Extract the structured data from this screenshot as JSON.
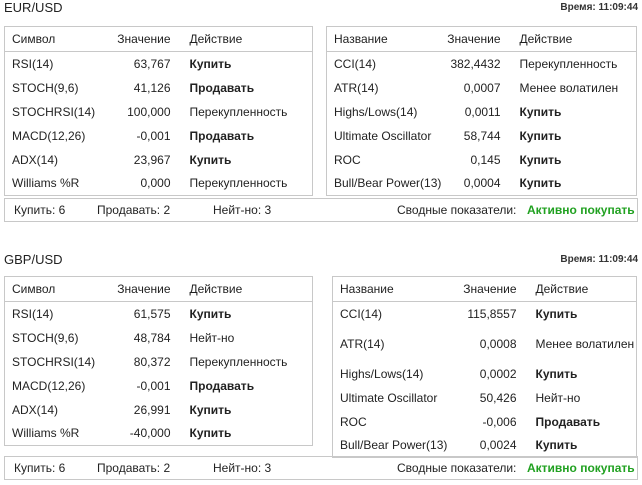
{
  "blocks": [
    {
      "pair": "EUR/USD",
      "time": "Время: 11:09:44",
      "left_headers": [
        "Символ",
        "Значение",
        "Действие"
      ],
      "left_rows": [
        {
          "name": "RSI(14)",
          "value": "63,767",
          "action": "Купить",
          "type": "buy"
        },
        {
          "name": "STOCH(9,6)",
          "value": "41,126",
          "action": "Продавать",
          "type": "sell"
        },
        {
          "name": "STOCHRSI(14)",
          "value": "100,000",
          "action": "Перекупленность",
          "type": "neutral"
        },
        {
          "name": "MACD(12,26)",
          "value": "-0,001",
          "action": "Продавать",
          "type": "sell"
        },
        {
          "name": "ADX(14)",
          "value": "23,967",
          "action": "Купить",
          "type": "buy"
        },
        {
          "name": "Williams %R",
          "value": "0,000",
          "action": "Перекупленность",
          "type": "neutral"
        }
      ],
      "right_headers": [
        "Название",
        "Значение",
        "Действие"
      ],
      "right_rows": [
        {
          "name": "CCI(14)",
          "value": "382,4432",
          "action": "Перекупленность",
          "type": "neutral"
        },
        {
          "name": "ATR(14)",
          "value": "0,0007",
          "action": "Менее волатилен",
          "type": "neutral"
        },
        {
          "name": "Highs/Lows(14)",
          "value": "0,0011",
          "action": "Купить",
          "type": "buy"
        },
        {
          "name": "Ultimate Oscillator",
          "value": "58,744",
          "action": "Купить",
          "type": "buy"
        },
        {
          "name": "ROC",
          "value": "0,145",
          "action": "Купить",
          "type": "buy"
        },
        {
          "name": "Bull/Bear Power(13)",
          "value": "0,0004",
          "action": "Купить",
          "type": "buy"
        }
      ],
      "summary": {
        "buy": "Купить: 6",
        "sell": "Продавать: 2",
        "neutral": "Нейт-но: 3",
        "overall_label": "Сводные показатели:",
        "overall_value": "Активно покупать"
      }
    },
    {
      "pair": "GBP/USD",
      "time": "Время: 11:09:44",
      "left_headers": [
        "Символ",
        "Значение",
        "Действие"
      ],
      "left_rows": [
        {
          "name": "RSI(14)",
          "value": "61,575",
          "action": "Купить",
          "type": "buy"
        },
        {
          "name": "STOCH(9,6)",
          "value": "48,784",
          "action": "Нейт-но",
          "type": "neutral"
        },
        {
          "name": "STOCHRSI(14)",
          "value": "80,372",
          "action": "Перекупленность",
          "type": "neutral"
        },
        {
          "name": "MACD(12,26)",
          "value": "-0,001",
          "action": "Продавать",
          "type": "sell"
        },
        {
          "name": "ADX(14)",
          "value": "26,991",
          "action": "Купить",
          "type": "buy"
        },
        {
          "name": "Williams %R",
          "value": "-40,000",
          "action": "Купить",
          "type": "buy"
        }
      ],
      "right_headers": [
        "Название",
        "Значение",
        "Действие"
      ],
      "right_rows": [
        {
          "name": "CCI(14)",
          "value": "115,8557",
          "action": "Купить",
          "type": "buy"
        },
        {
          "name": "ATR(14)",
          "value": "0,0008",
          "action": "Менее волатилен",
          "type": "neutral"
        },
        {
          "name": "Highs/Lows(14)",
          "value": "0,0002",
          "action": "Купить",
          "type": "buy"
        },
        {
          "name": "Ultimate Oscillator",
          "value": "50,426",
          "action": "Нейт-но",
          "type": "neutral"
        },
        {
          "name": "ROC",
          "value": "-0,006",
          "action": "Продавать",
          "type": "sell"
        },
        {
          "name": "Bull/Bear Power(13)",
          "value": "0,0024",
          "action": "Купить",
          "type": "buy"
        }
      ],
      "summary": {
        "buy": "Купить: 6",
        "sell": "Продавать: 2",
        "neutral": "Нейт-но: 3",
        "overall_label": "Сводные показатели:",
        "overall_value": "Активно покупать"
      }
    }
  ],
  "colors": {
    "buy": "#21a121",
    "sell": "#e00000",
    "border": "#c8c8c8"
  }
}
